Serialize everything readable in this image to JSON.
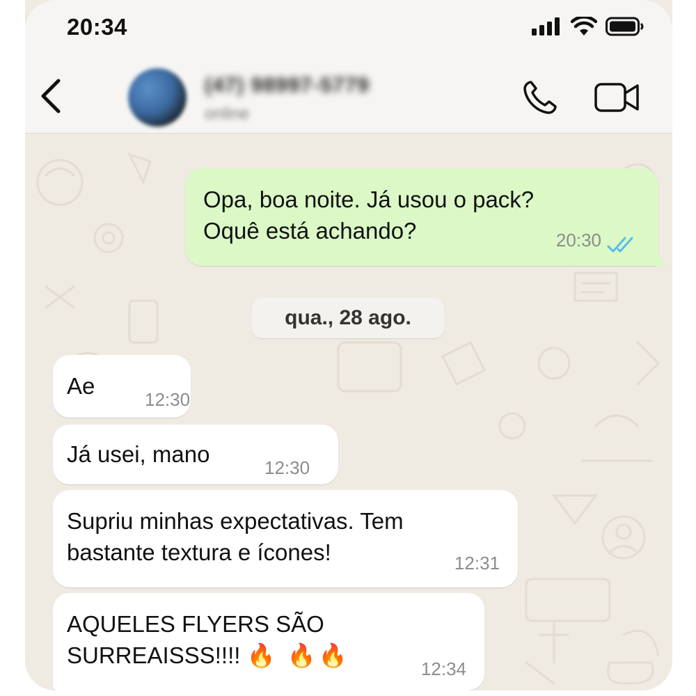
{
  "status_bar": {
    "time": "20:34",
    "icons": [
      "signal-icon",
      "wifi-icon",
      "battery-icon"
    ]
  },
  "header": {
    "contact_name": "(47) 98997-5779",
    "contact_status": "online",
    "icons": [
      "back-icon",
      "phone-icon",
      "video-icon"
    ]
  },
  "date_divider": "qua., 28 ago.",
  "messages": [
    {
      "direction": "outgoing",
      "lines": [
        "Opa, boa noite. Já usou o pack?",
        "Oquê está achando?"
      ],
      "time": "20:30",
      "status": "read"
    },
    {
      "direction": "incoming",
      "lines": [
        "Ae"
      ],
      "time": "12:30"
    },
    {
      "direction": "incoming",
      "lines": [
        "Já usei, mano"
      ],
      "time": "12:30"
    },
    {
      "direction": "incoming",
      "lines": [
        "Supriu minhas expectativas. Tem",
        "bastante textura e ícones!"
      ],
      "time": "12:31"
    },
    {
      "direction": "incoming",
      "lines": [
        "AQUELES FLYERS SÃO",
        "SURREAISSS!!!!"
      ],
      "emoji": "🔥 🔥🔥",
      "time": "12:34"
    }
  ],
  "colors": {
    "outgoing_bubble": "#dbf8c6",
    "incoming_bubble": "#ffffff",
    "chat_background": "#efeae2",
    "read_ticks": "#53bdeb"
  }
}
